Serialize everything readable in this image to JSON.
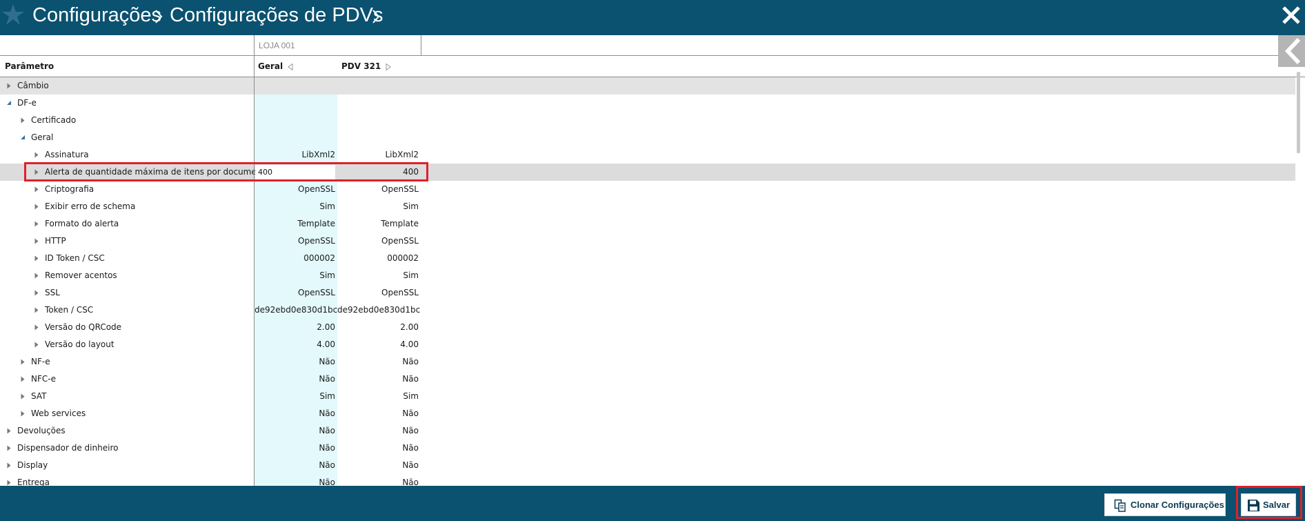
{
  "header": {
    "crumb_1": "Configurações",
    "crumb_2": "Configurações de PDVs"
  },
  "grid": {
    "store": "LOJA 001",
    "col_param": "Parâmetro",
    "col_geral": "Geral",
    "col_pdv": "PDV 321",
    "rows": [
      {
        "label": "Câmbio",
        "geral": "",
        "pdv": ""
      },
      {
        "label": "DF-e",
        "geral": "",
        "pdv": ""
      },
      {
        "label": "Certificado",
        "geral": "",
        "pdv": ""
      },
      {
        "label": "Geral",
        "geral": "",
        "pdv": ""
      },
      {
        "label": "Assinatura",
        "geral": "LibXml2",
        "pdv": "LibXml2"
      },
      {
        "label": "Alerta de quantidade máxima de itens por documento",
        "geral": "400",
        "pdv": "400"
      },
      {
        "label": "Criptografia",
        "geral": "OpenSSL",
        "pdv": "OpenSSL"
      },
      {
        "label": "Exibir erro de schema",
        "geral": "Sim",
        "pdv": "Sim"
      },
      {
        "label": "Formato do alerta",
        "geral": "Template",
        "pdv": "Template"
      },
      {
        "label": "HTTP",
        "geral": "OpenSSL",
        "pdv": "OpenSSL"
      },
      {
        "label": "ID Token / CSC",
        "geral": "000002",
        "pdv": "000002"
      },
      {
        "label": "Remover acentos",
        "geral": "Sim",
        "pdv": "Sim"
      },
      {
        "label": "SSL",
        "geral": "OpenSSL",
        "pdv": "OpenSSL"
      },
      {
        "label": "Token / CSC",
        "geral": "de92ebd0e830d1bc",
        "pdv": "de92ebd0e830d1bc"
      },
      {
        "label": "Versão do QRCode",
        "geral": "2.00",
        "pdv": "2.00"
      },
      {
        "label": "Versão do layout",
        "geral": "4.00",
        "pdv": "4.00"
      },
      {
        "label": "NF-e",
        "geral": "Não",
        "pdv": "Não"
      },
      {
        "label": "NFC-e",
        "geral": "Não",
        "pdv": "Não"
      },
      {
        "label": "SAT",
        "geral": "Sim",
        "pdv": "Sim"
      },
      {
        "label": "Web services",
        "geral": "Não",
        "pdv": "Não"
      },
      {
        "label": "Devoluções",
        "geral": "Não",
        "pdv": "Não"
      },
      {
        "label": "Dispensador de dinheiro",
        "geral": "Não",
        "pdv": "Não"
      },
      {
        "label": "Display",
        "geral": "Não",
        "pdv": "Não"
      },
      {
        "label": "Entrega",
        "geral": "Não",
        "pdv": "Não"
      }
    ]
  },
  "footer": {
    "clone_label": "Clonar Configurações",
    "save_label": "Salvar"
  },
  "colors": {
    "brand": "#0b5170",
    "geral_column": "#e3f9fc",
    "highlight_box": "#e0202a"
  }
}
